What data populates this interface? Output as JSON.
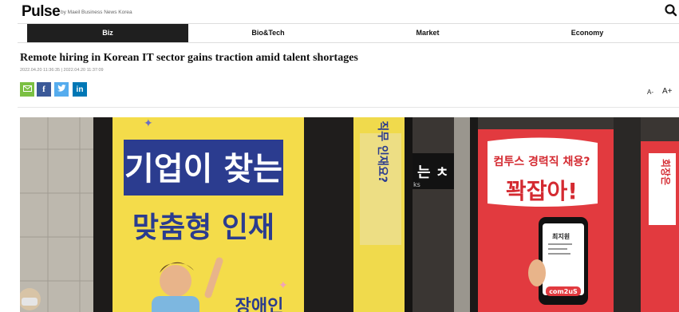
{
  "header": {
    "logo": "Pulse",
    "logo_sub": "by Maeil Business News Korea"
  },
  "nav": [
    {
      "label": "Biz",
      "active": true
    },
    {
      "label": "Bio&Tech",
      "active": false
    },
    {
      "label": "Market",
      "active": false
    },
    {
      "label": "Economy",
      "active": false
    }
  ],
  "article": {
    "headline": "Remote hiring in Korean IT sector gains traction amid talent shortages",
    "dates": "2022.04.20 11:36:35 | 2022.04.20 11:37:09"
  },
  "share": {
    "email_color": "#7bc043",
    "facebook_color": "#3b5998",
    "twitter_color": "#55acee",
    "linkedin_color": "#0077b5"
  },
  "font_size": {
    "decrease": "A-",
    "increase": "A+"
  },
  "photo": {
    "poster_left_line1": "기업이 찾는",
    "poster_left_line2": "맞춤형 인재",
    "poster_left_line3": "장애인",
    "poster_mid": "IT 전문 직무 인재요?",
    "sign_text": "는 ㅊ",
    "sign_sub": "ks",
    "poster_right_line1": "컴투스 경력직 채용?",
    "poster_right_line2": "꽉잡아!",
    "phone_name": "최지원",
    "brand": "com2uS",
    "poster_far_right": "회장은"
  }
}
